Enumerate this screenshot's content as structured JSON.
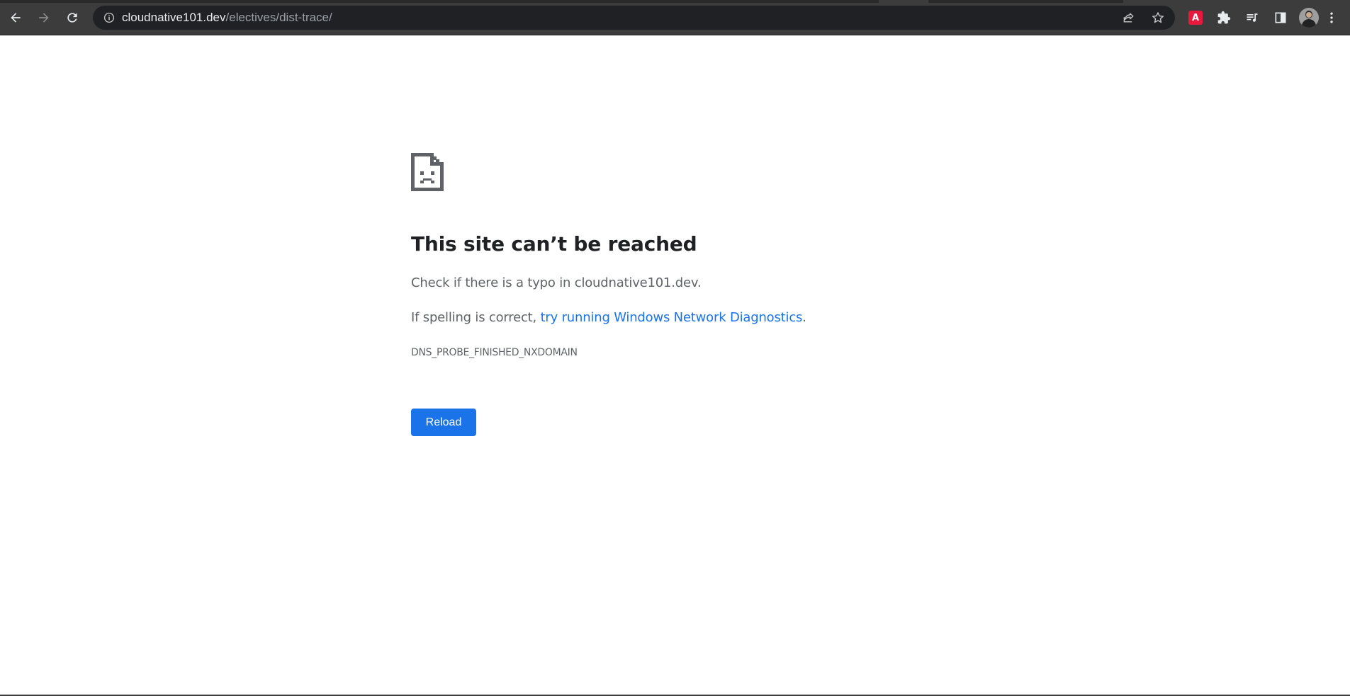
{
  "browser": {
    "url_host": "cloudnative101.dev",
    "url_path": "/electives/dist-trace/",
    "buttons": {
      "back": "back-icon",
      "forward": "forward-icon",
      "reload": "reload-icon",
      "site_info": "info-icon",
      "share": "share-icon",
      "bookmark": "star-icon",
      "extension": "adobe-acrobat-icon",
      "extensions_menu": "puzzle-icon",
      "media": "media-queue-icon",
      "side_panel": "side-panel-icon",
      "profile": "avatar",
      "menu": "kebab-menu-icon"
    },
    "extension_badge": "A"
  },
  "error": {
    "title": "This site can’t be reached",
    "line1": "Check if there is a typo in cloudnative101.dev.",
    "line2_prefix": "If spelling is correct, ",
    "line2_link": "try running Windows Network Diagnostics",
    "line2_suffix": ".",
    "code": "DNS_PROBE_FINISHED_NXDOMAIN",
    "reload_label": "Reload"
  },
  "colors": {
    "toolbar": "#3c3c3c",
    "omnibox": "#202124",
    "link": "#1a73e8",
    "button": "#1a73e8",
    "title": "#202124",
    "body_text": "#5f6368"
  }
}
